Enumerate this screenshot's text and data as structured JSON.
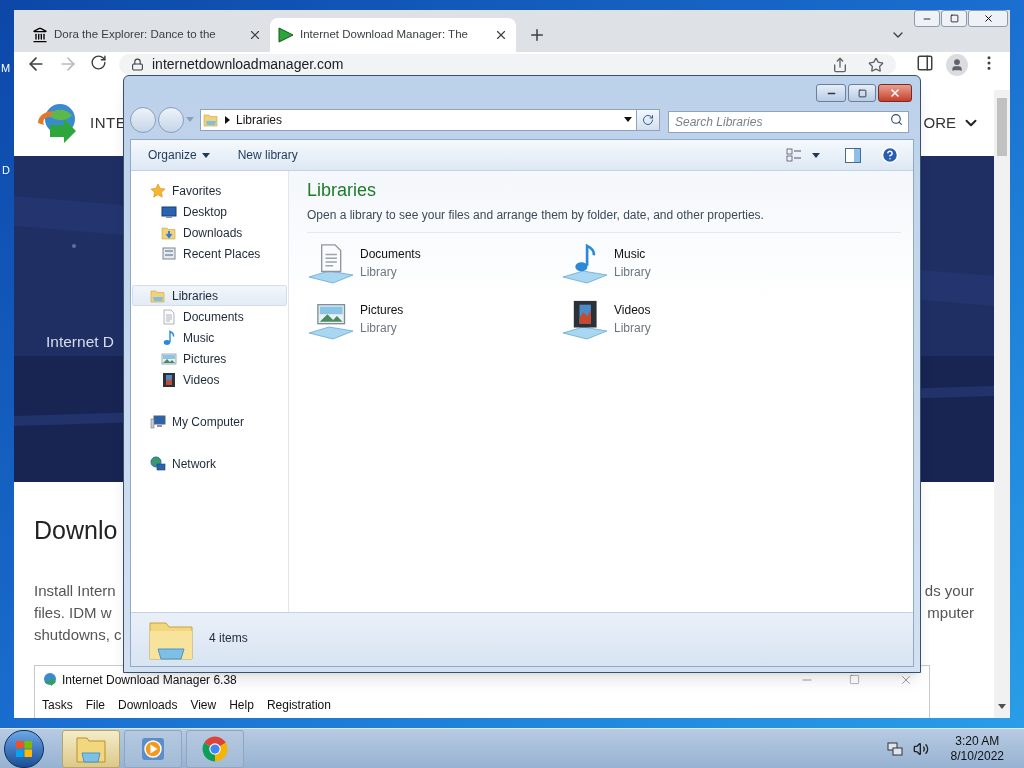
{
  "desktop": {
    "edge_labels": [
      "M",
      "D"
    ]
  },
  "browser": {
    "tabs": [
      {
        "title": "Dora the Explorer: Dance to the",
        "kind": "landmark",
        "selected": false
      },
      {
        "title": "Internet Download Manager: The",
        "kind": "idm",
        "selected": true
      }
    ],
    "address": "internetdownloadmanager.com",
    "page": {
      "brand": "INTE",
      "nav_more": "ORE",
      "banner_text": "Internet D",
      "heading": "Downlo",
      "text_left": [
        "Install Intern",
        "files. IDM w",
        "shutdowns, c"
      ],
      "text_right": [
        "ds your",
        "mputer"
      ]
    },
    "idm": {
      "title": "Internet Download Manager 6.38",
      "menu": [
        "Tasks",
        "File",
        "Downloads",
        "View",
        "Help",
        "Registration"
      ]
    }
  },
  "explorer": {
    "breadcrumb": "Libraries",
    "search": {
      "placeholder": "Search Libraries"
    },
    "commands": [
      {
        "label": "Organize",
        "menu": true
      },
      {
        "label": "New library",
        "menu": false
      }
    ],
    "sidebar": [
      {
        "label": "Favorites",
        "kind": "star",
        "selected": false,
        "children": [
          {
            "label": "Desktop",
            "kind": "desktop",
            "selected": false
          },
          {
            "label": "Downloads",
            "kind": "downloads",
            "selected": false
          },
          {
            "label": "Recent Places",
            "kind": "recent",
            "selected": false
          }
        ]
      },
      {
        "label": "Libraries",
        "kind": "libraries",
        "selected": true,
        "children": [
          {
            "label": "Documents",
            "kind": "documents",
            "selected": false
          },
          {
            "label": "Music",
            "kind": "music",
            "selected": false
          },
          {
            "label": "Pictures",
            "kind": "pictures",
            "selected": false
          },
          {
            "label": "Videos",
            "kind": "videos",
            "selected": false
          }
        ]
      },
      {
        "label": "My Computer",
        "kind": "computer",
        "selected": false
      },
      {
        "label": "Network",
        "kind": "network",
        "selected": false
      }
    ],
    "heading": "Libraries",
    "description": "Open a library to see your files and arrange them by folder, date, and other properties.",
    "items": [
      {
        "name": "Documents",
        "type": "Library",
        "kind": "documents"
      },
      {
        "name": "Music",
        "type": "Library",
        "kind": "music"
      },
      {
        "name": "Pictures",
        "type": "Library",
        "kind": "pictures"
      },
      {
        "name": "Videos",
        "type": "Library",
        "kind": "videos"
      }
    ],
    "status": "4 items"
  },
  "taskbar": {
    "apps": [
      {
        "kind": "explorer",
        "selected": true
      },
      {
        "kind": "media",
        "selected": false
      },
      {
        "kind": "chrome",
        "selected": false
      }
    ],
    "time": "3:20 AM",
    "date": "8/10/2022"
  }
}
